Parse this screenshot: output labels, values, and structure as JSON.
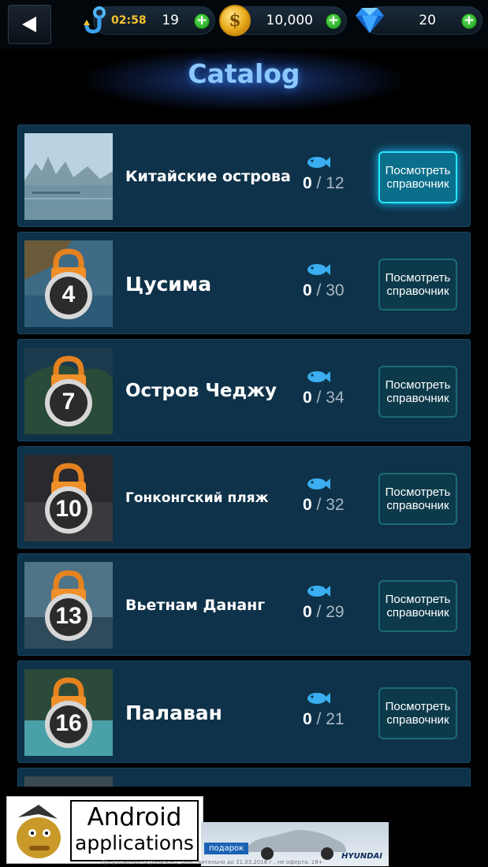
{
  "topbar": {
    "timer": "02:58",
    "bait_count": "19",
    "coins": "10,000",
    "gems": "20",
    "coin_symbol": "$"
  },
  "header": {
    "title": "Catalog"
  },
  "locations": [
    {
      "name": "Китайские острова",
      "caught": "0",
      "total": "/ 12",
      "level": null,
      "button": "Посмотреть справочник",
      "active": true
    },
    {
      "name": "Цусима",
      "caught": "0",
      "total": "/ 30",
      "level": "4",
      "button": "Посмотреть справочник",
      "active": false
    },
    {
      "name": "Остров Чеджу",
      "caught": "0",
      "total": "/ 34",
      "level": "7",
      "button": "Посмотреть справочник",
      "active": false
    },
    {
      "name": "Гонконгский пляж",
      "caught": "0",
      "total": "/ 32",
      "level": "10",
      "button": "Посмотреть справочник",
      "active": false
    },
    {
      "name": "Вьетнам Дананг",
      "caught": "0",
      "total": "/ 29",
      "level": "13",
      "button": "Посмотреть справочник",
      "active": false
    },
    {
      "name": "Палаван",
      "caught": "0",
      "total": "/ 21",
      "level": "16",
      "button": "Посмотреть справочник",
      "active": false
    }
  ],
  "ad": {
    "title_1": "Android",
    "title_2": "applications",
    "gift": "подарок",
    "brand": "HYUNDAI",
    "fine_print": "Предложение ограничено, действительно до 31.03.2018 г., не оферта. 18+"
  },
  "colors": {
    "row_bg": "#0e3249",
    "accent": "#27e5ff",
    "title": "#8cc8ff",
    "timer": "#f6c12b"
  }
}
